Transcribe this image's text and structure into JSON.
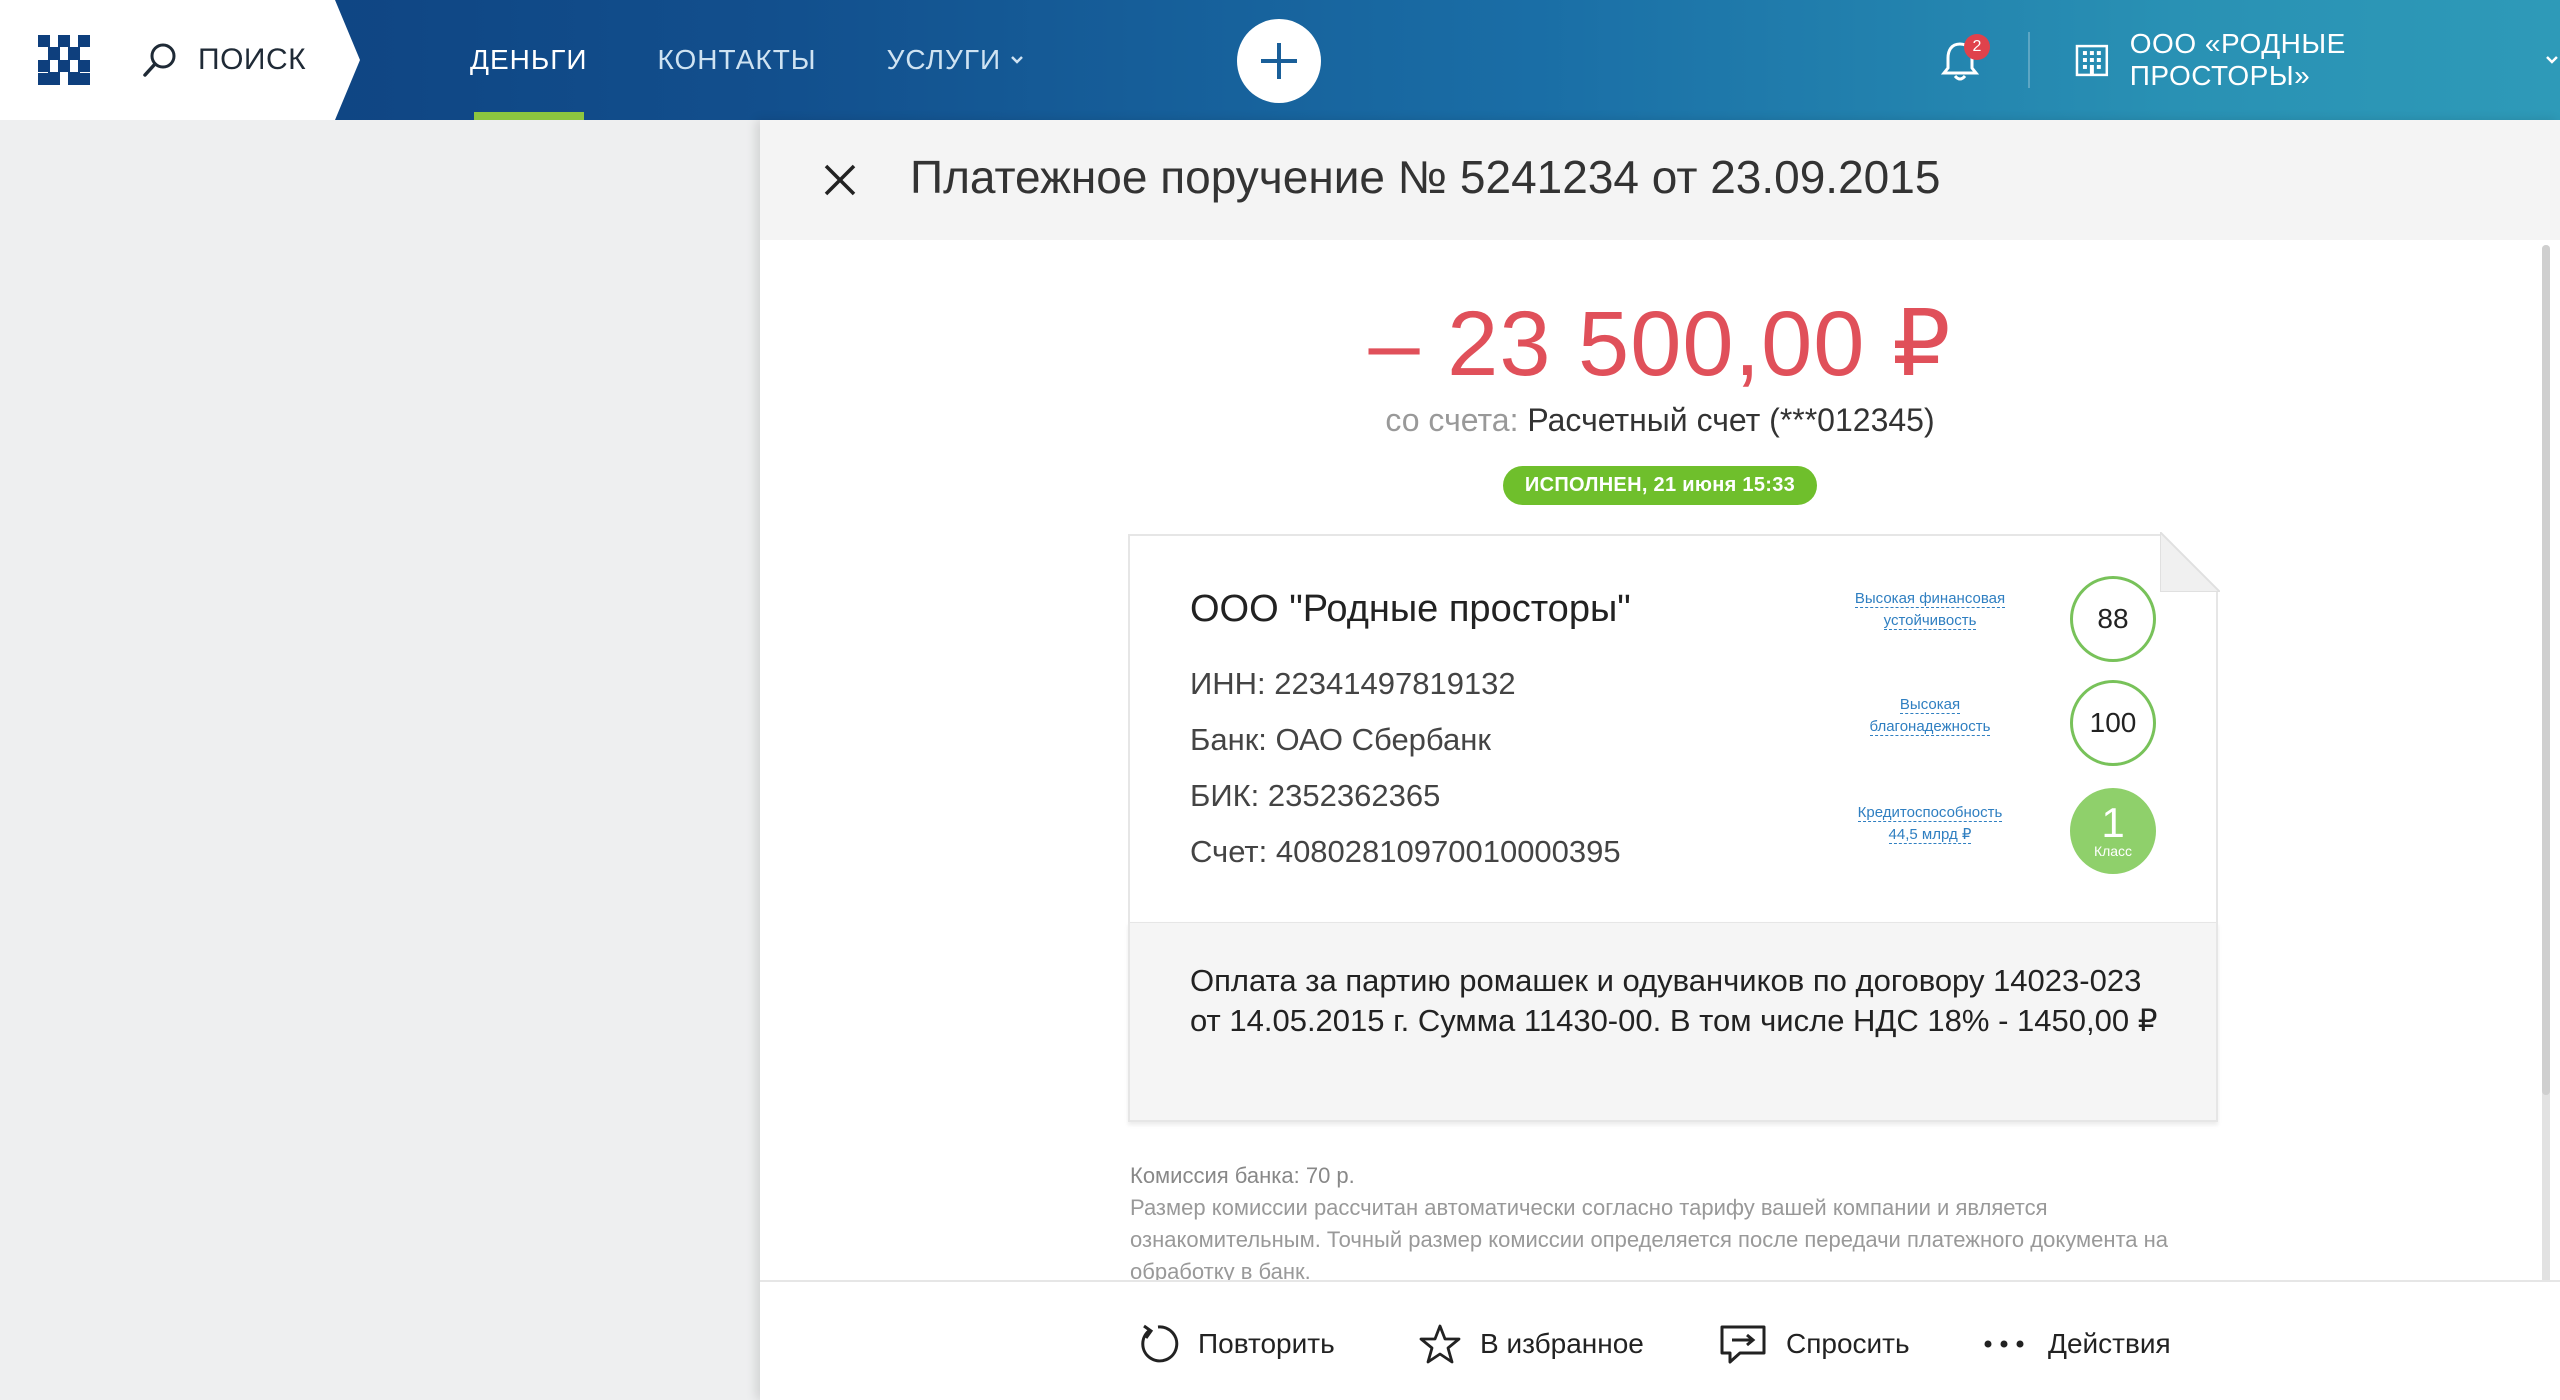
{
  "header": {
    "search_label": "ПОИСК",
    "nav": [
      {
        "label": "ДЕНЬГИ",
        "active": true
      },
      {
        "label": "КОНТАКТЫ",
        "active": false
      },
      {
        "label": "УСЛУГИ",
        "active": false,
        "dropdown": true
      }
    ],
    "notifications_count": "2",
    "company_name": "ООО «РОДНЫЕ ПРОСТОРЫ»",
    "colors": {
      "accent": "#8cc63f",
      "gradient_start": "#0d3e7c",
      "gradient_end": "#2e9ab8"
    }
  },
  "panel": {
    "title": "Платежное поручение № 5241234 от 23.09.2015",
    "amount": "– 23 500,00 ₽",
    "from_label": "со счета:",
    "from_value": "Расчетный счет (***012345)",
    "status": "ИСПОЛНЕН, 21 июня 15:33",
    "counterparty": {
      "name": "ООО \"Родные просторы\"",
      "inn": "ИНН: 22341497819132",
      "bank": "Банк: ОАО Сбербанк",
      "bik": "БИК: 2352362365",
      "account": "Счет: 40802810970010000395"
    },
    "ratings": [
      {
        "label_line1": "Высокая финансовая",
        "label_line2": "устойчивость",
        "value": "88"
      },
      {
        "label_line1": "Высокая",
        "label_line2": "благонадежность",
        "value": "100"
      },
      {
        "label_line1": "Кредитоспособность",
        "label_line2": "44,5 млрд ₽",
        "value": "1",
        "sub": "Класс"
      }
    ],
    "purpose": "Оплата за партию ромашек и одуванчиков по договору 14023-023 от 14.05.2015 г. Сумма 11430-00. В том числе НДС 18% - 1450,00 ₽",
    "commission_title": "Комиссия банка: 70 р.",
    "commission_text": "Размер комиссии рассчитан автоматически согласно тарифу вашей компании и является ознакомительным. Точный размер комиссии определяется после передачи платежного документа на обработку в банк.",
    "amount_color": "#e0505a",
    "status_color": "#6fbf2c"
  },
  "footer": {
    "repeat": "Повторить",
    "favorite": "В избранное",
    "ask": "Спросить",
    "actions": "Действия"
  }
}
